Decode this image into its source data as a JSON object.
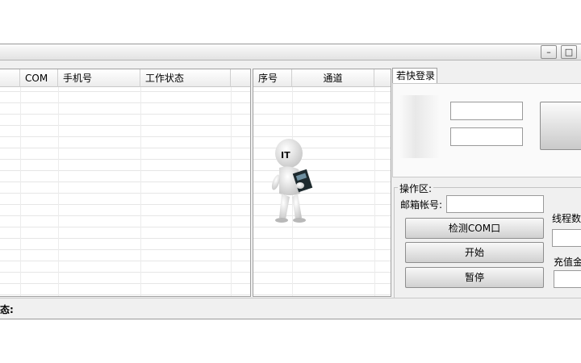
{
  "window": {
    "minimize_glyph": "–",
    "maximize_glyph": "□"
  },
  "left_table": {
    "columns": [
      "COM",
      "手机号",
      "工作状态"
    ]
  },
  "right_table": {
    "columns": [
      "序号",
      "通道"
    ]
  },
  "mascot": {
    "label": "IT"
  },
  "login_tab": {
    "label": "若快登录"
  },
  "operation_area": {
    "title": "操作区:",
    "email_label": "邮箱帐号:",
    "email_value": "",
    "detect_button": "检测COM口",
    "start_button": "开始",
    "pause_button": "暂停",
    "thread_label": "线程数",
    "recharge_label": "充值金"
  },
  "status_bar": {
    "label": "态:"
  }
}
